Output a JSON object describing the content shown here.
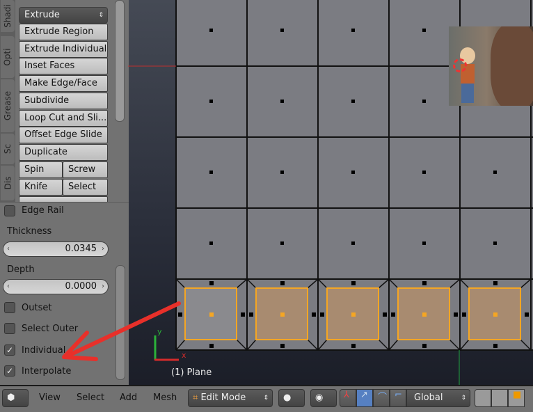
{
  "side_tabs": [
    "Shadi",
    "Opti",
    "Grease",
    "Sc",
    "Dis"
  ],
  "tool_dropdown": "Extrude",
  "tools": [
    "Extrude Region",
    "Extrude Individual",
    "Inset Faces",
    "Make Edge/Face",
    "Subdivide",
    "Loop Cut and Sli...",
    "Offset Edge Slide",
    "Duplicate"
  ],
  "tool_pairs": [
    [
      "Spin",
      "Screw"
    ],
    [
      "Knife",
      "Select"
    ]
  ],
  "operator": {
    "edge_rail": {
      "label": "Edge Rail",
      "checked": false
    },
    "thickness": {
      "label": "Thickness",
      "value": "0.0345"
    },
    "depth": {
      "label": "Depth",
      "value": "0.0000"
    },
    "outset": {
      "label": "Outset",
      "checked": false
    },
    "select_outer": {
      "label": "Select Outer",
      "checked": false
    },
    "individual": {
      "label": "Individual",
      "checked": true
    },
    "interpolate": {
      "label": "Interpolate",
      "checked": true
    }
  },
  "viewport": {
    "object_label": "(1) Plane",
    "axis_x": "x",
    "axis_y": "y",
    "selected_color": "#f5a623",
    "annotation_color": "#e8302a"
  },
  "header": {
    "menus": [
      "View",
      "Select",
      "Add",
      "Mesh"
    ],
    "mode": "Edit Mode",
    "orientation": "Global"
  }
}
